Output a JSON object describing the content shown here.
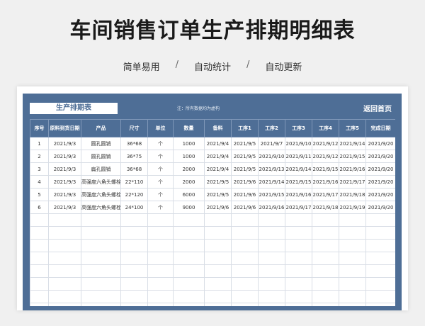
{
  "page": {
    "title": "车间销售订单生产排期明细表",
    "subtitle_items": [
      "简单易用",
      "/",
      "自动统计",
      "/",
      "自动更新"
    ]
  },
  "sheet": {
    "title": "生产排期表",
    "note": "注：所有数据均为虚构",
    "home_button": "返回首页"
  },
  "table": {
    "headers": [
      "序号",
      "原料到货日期",
      "产品",
      "尺寸",
      "单位",
      "数量",
      "备料",
      "工序1",
      "工序2",
      "工序3",
      "工序4",
      "工序5",
      "完成日期"
    ],
    "rows": [
      [
        "1",
        "2021/9/3",
        "圆孔圆销",
        "36*68",
        "个",
        "1000",
        "2021/9/4",
        "2021/9/5",
        "2021/9/7",
        "2021/9/10",
        "2021/9/12",
        "2021/9/14",
        "2021/9/20"
      ],
      [
        "2",
        "2021/9/3",
        "圆孔圆销",
        "36*75",
        "个",
        "1000",
        "2021/9/4",
        "2021/9/5",
        "2021/9/10",
        "2021/9/11",
        "2021/9/12",
        "2021/9/15",
        "2021/9/20"
      ],
      [
        "3",
        "2021/9/3",
        "扁孔圆销",
        "36*68",
        "个",
        "2000",
        "2021/9/4",
        "2021/9/5",
        "2021/9/13",
        "2021/9/14",
        "2021/9/15",
        "2021/9/16",
        "2021/9/20"
      ],
      [
        "4",
        "2021/9/3",
        "高强度六角头螺栓",
        "22*110",
        "个",
        "2000",
        "2021/9/5",
        "2021/9/6",
        "2021/9/14",
        "2021/9/15",
        "2021/9/16",
        "2021/9/17",
        "2021/9/20"
      ],
      [
        "5",
        "2021/9/3",
        "高强度六角头螺栓",
        "22*120",
        "个",
        "6000",
        "2021/9/5",
        "2021/9/6",
        "2021/9/15",
        "2021/9/16",
        "2021/9/17",
        "2021/9/18",
        "2021/9/20"
      ],
      [
        "6",
        "2021/9/3",
        "高强度六角头螺栓",
        "24*100",
        "个",
        "9000",
        "2021/9/6",
        "2021/9/6",
        "2021/9/16",
        "2021/9/17",
        "2021/9/18",
        "2021/9/19",
        "2021/9/20"
      ]
    ]
  }
}
